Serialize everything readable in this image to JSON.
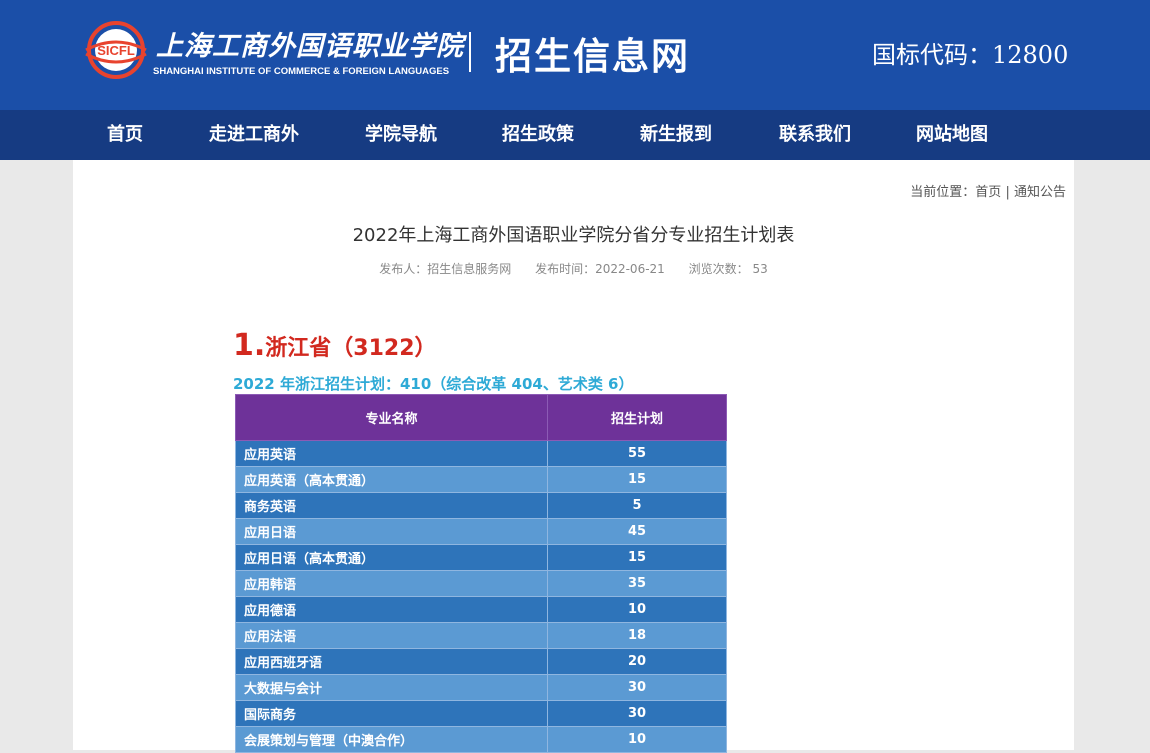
{
  "header": {
    "logo_badge": "SICFL",
    "logo_cn": "上海工商外国语职业学院",
    "logo_en": "SHANGHAI INSTITUTE OF COMMERCE & FOREIGN LANGUAGES",
    "site_title": "招生信息网",
    "code": "国标代码：12800",
    "colors": {
      "header_bg": "#1b4fa8",
      "nav_bg": "#163b82"
    }
  },
  "nav": {
    "items": [
      {
        "label": "首页"
      },
      {
        "label": "走进工商外"
      },
      {
        "label": "学院导航"
      },
      {
        "label": "招生政策"
      },
      {
        "label": "新生报到"
      },
      {
        "label": "联系我们"
      },
      {
        "label": "网站地图"
      }
    ]
  },
  "breadcrumb": {
    "prefix": "当前位置：",
    "home": "首页",
    "separator": "|",
    "current": "通知公告"
  },
  "article": {
    "title": "2022年上海工商外国语职业学院分省分专业招生计划表",
    "publisher": "发布人：招生信息服务网",
    "date": "发布时间：2022-06-21",
    "views_label": "浏览次数：",
    "views": "53"
  },
  "province": {
    "number": "1.",
    "title": "浙江省（3122）",
    "summary": "2022 年浙江招生计划：410（综合改革 404、艺术类 6）",
    "table": {
      "headers": [
        "专业名称",
        "招生计划"
      ],
      "rows": [
        {
          "name": "应用英语",
          "count": "55"
        },
        {
          "name": "应用英语（高本贯通）",
          "count": "15"
        },
        {
          "name": "商务英语",
          "count": "5"
        },
        {
          "name": "应用日语",
          "count": "45"
        },
        {
          "name": "应用日语（高本贯通）",
          "count": "15"
        },
        {
          "name": "应用韩语",
          "count": "35"
        },
        {
          "name": "应用德语",
          "count": "10"
        },
        {
          "name": "应用法语",
          "count": "18"
        },
        {
          "name": "应用西班牙语",
          "count": "20"
        },
        {
          "name": "大数据与会计",
          "count": "30"
        },
        {
          "name": "国际商务",
          "count": "30"
        },
        {
          "name": "会展策划与管理（中澳合作）",
          "count": "10"
        }
      ],
      "colors": {
        "header": "#6e3299",
        "row_dark": "#2e74ba",
        "row_light": "#5b9ad3"
      }
    }
  }
}
